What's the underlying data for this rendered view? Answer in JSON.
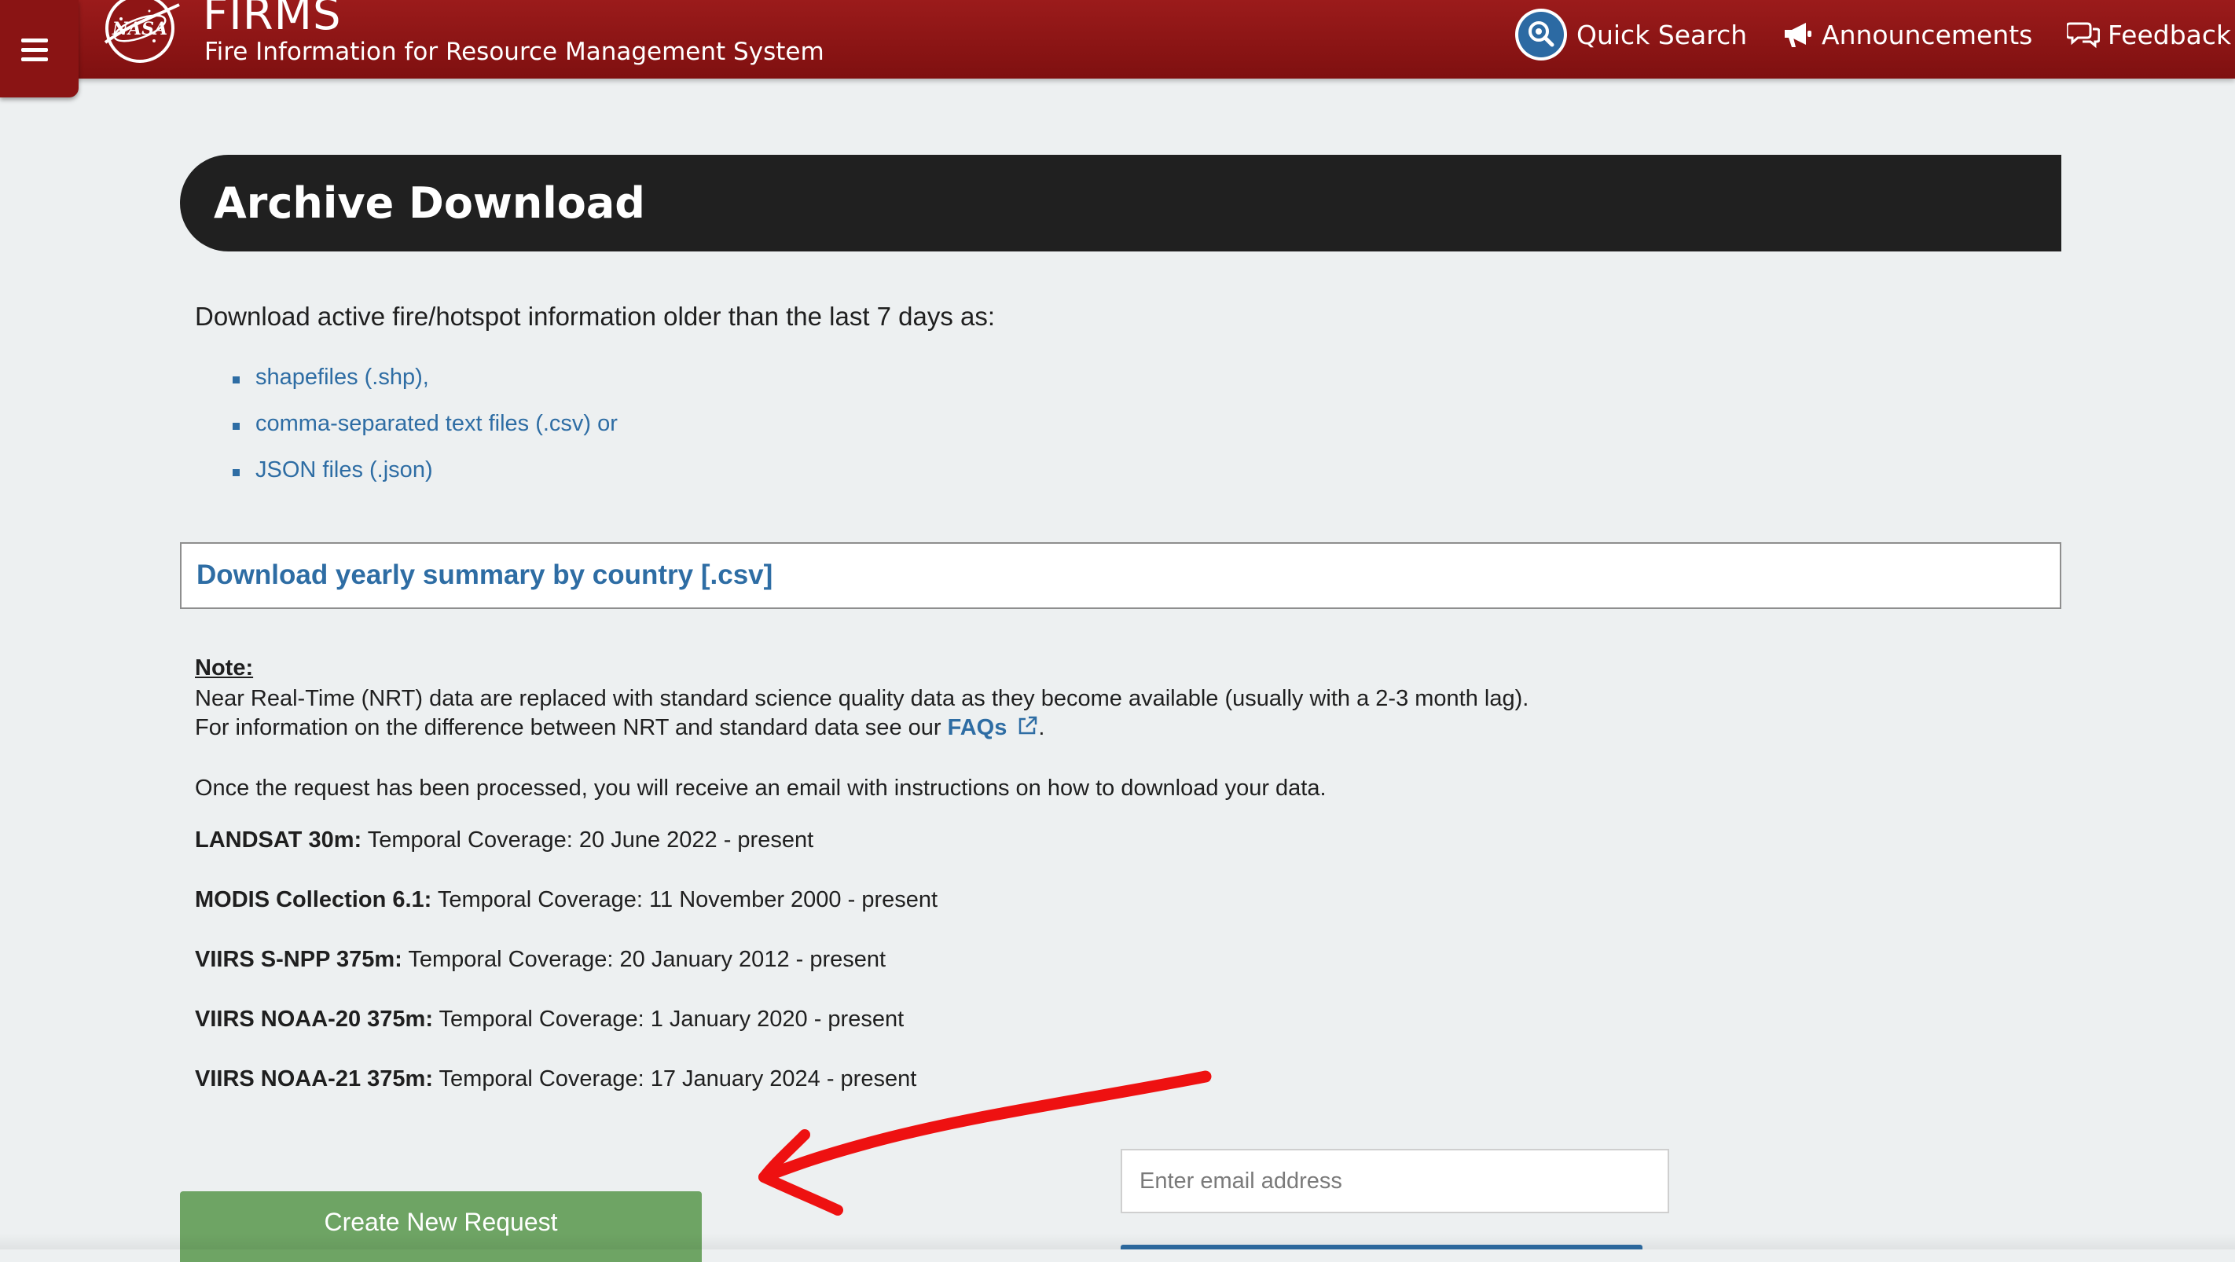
{
  "header": {
    "brand_title": "FIRMS",
    "brand_subtitle": "Fire Information for Resource Management System",
    "logo_text": "NASA",
    "nav": {
      "quick_search": "Quick Search",
      "announcements": "Announcements",
      "feedback": "Feedback"
    }
  },
  "page": {
    "title": "Archive Download",
    "intro": "Download active fire/hotspot information older than the last 7 days as:",
    "formats": [
      "shapefiles (.shp),",
      "comma-separated text files (.csv) or",
      "JSON files (.json)"
    ],
    "summary_link": "Download yearly summary by country [.csv]",
    "note": {
      "heading": "Note:",
      "line1": "Near Real-Time (NRT) data are replaced with standard science quality data as they become available (usually with a 2-3 month lag).",
      "line2_prefix": "For information on the difference between NRT and standard data see our ",
      "faq_link": "FAQs",
      "line2_suffix": "."
    },
    "processed_text": "Once the request has been processed, you will receive an email with instructions on how to download your data.",
    "coverage": [
      {
        "name": "LANDSAT 30m:",
        "text": " Temporal Coverage: 20 June 2022 - present"
      },
      {
        "name": "MODIS Collection 6.1:",
        "text": " Temporal Coverage: 11 November 2000 - present"
      },
      {
        "name": "VIIRS S-NPP 375m:",
        "text": " Temporal Coverage: 20 January 2012 - present"
      },
      {
        "name": "VIIRS NOAA-20 375m:",
        "text": " Temporal Coverage: 1 January 2020 - present"
      },
      {
        "name": "VIIRS NOAA-21 375m:",
        "text": " Temporal Coverage: 17 January 2024 - present"
      }
    ],
    "create_button": "Create New Request",
    "email_placeholder": "Enter email address"
  },
  "colors": {
    "header_red": "#8e1515",
    "banner_dark": "#202020",
    "link_blue": "#2e6da4",
    "button_green": "#6ea464",
    "annotation_red": "#ee1111"
  },
  "icons": {
    "menu": "hamburger-icon",
    "quick_search": "search-icon",
    "announcements": "megaphone-icon",
    "feedback": "chat-bubbles-icon",
    "faq_external": "external-link-icon"
  }
}
